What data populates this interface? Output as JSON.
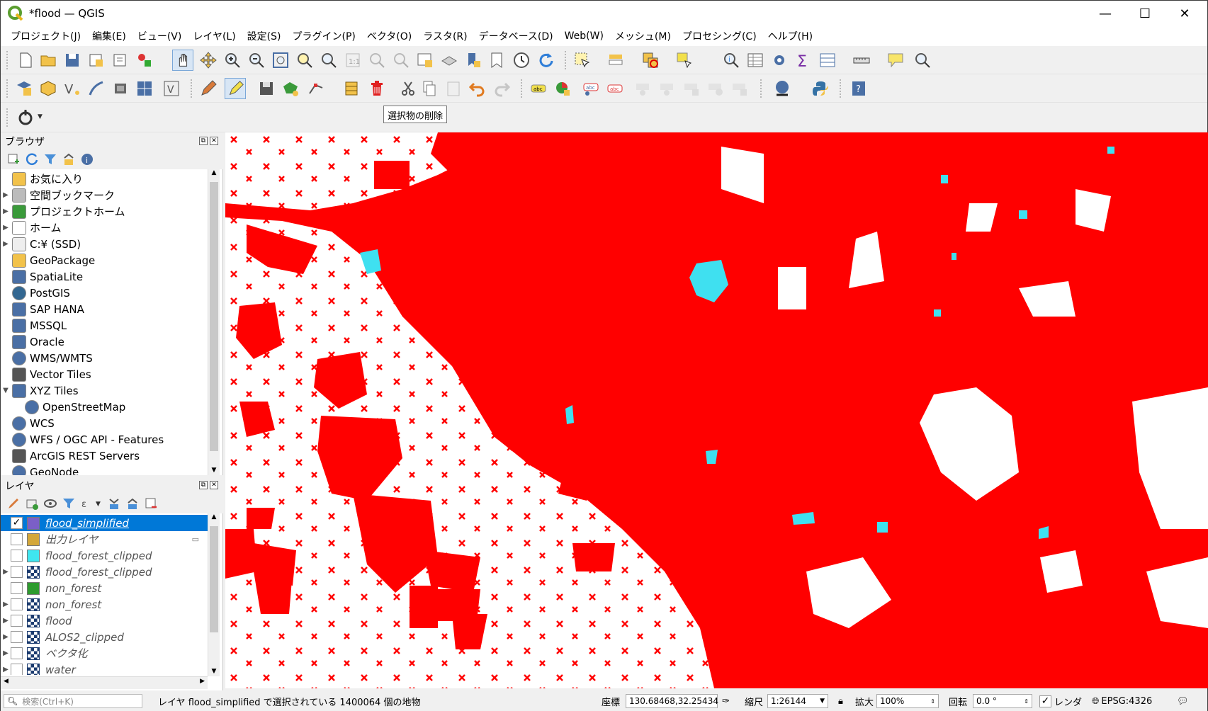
{
  "window": {
    "title": "*flood — QGIS"
  },
  "menu": [
    "プロジェクト(J)",
    "編集(E)",
    "ビュー(V)",
    "レイヤ(L)",
    "設定(S)",
    "プラグイン(P)",
    "ベクタ(O)",
    "ラスタ(R)",
    "データベース(D)",
    "Web(W)",
    "メッシュ(M)",
    "プロセシング(C)",
    "ヘルプ(H)"
  ],
  "tooltip": {
    "text": "選択物の削除"
  },
  "browser": {
    "title": "ブラウザ",
    "items": [
      {
        "label": "お気に入り",
        "arrow": "",
        "icon": "star-icon"
      },
      {
        "label": "空間ブックマーク",
        "arrow": "▶",
        "icon": "bookmark-icon"
      },
      {
        "label": "プロジェクトホーム",
        "arrow": "▶",
        "icon": "project-home-icon"
      },
      {
        "label": "ホーム",
        "arrow": "▶",
        "icon": "home-icon"
      },
      {
        "label": "C:¥ (SSD)",
        "arrow": "▶",
        "icon": "drive-icon"
      },
      {
        "label": "GeoPackage",
        "arrow": "",
        "icon": "geopackage-icon"
      },
      {
        "label": "SpatiaLite",
        "arrow": "",
        "icon": "spatialite-icon"
      },
      {
        "label": "PostGIS",
        "arrow": "",
        "icon": "postgis-icon"
      },
      {
        "label": "SAP HANA",
        "arrow": "",
        "icon": "hana-icon"
      },
      {
        "label": "MSSQL",
        "arrow": "",
        "icon": "mssql-icon"
      },
      {
        "label": "Oracle",
        "arrow": "",
        "icon": "oracle-icon"
      },
      {
        "label": "WMS/WMTS",
        "arrow": "",
        "icon": "wms-icon"
      },
      {
        "label": "Vector Tiles",
        "arrow": "",
        "icon": "vector-tiles-icon"
      },
      {
        "label": "XYZ Tiles",
        "arrow": "▼",
        "icon": "xyz-icon"
      },
      {
        "label": "OpenStreetMap",
        "arrow": "",
        "icon": "osm-icon",
        "indent": true
      },
      {
        "label": "WCS",
        "arrow": "",
        "icon": "wcs-icon"
      },
      {
        "label": "WFS / OGC API - Features",
        "arrow": "",
        "icon": "wfs-icon"
      },
      {
        "label": "ArcGIS REST Servers",
        "arrow": "",
        "icon": "arcgis-icon"
      },
      {
        "label": "GeoNode",
        "arrow": "",
        "icon": "geonode-icon"
      }
    ]
  },
  "layers": {
    "title": "レイヤ",
    "items": [
      {
        "label": "flood_simplified",
        "checked": true,
        "arrow": "",
        "swatch": "#7b5fc7",
        "selected": true
      },
      {
        "label": "出力レイヤ",
        "checked": false,
        "arrow": "",
        "swatch": "#d4a73a"
      },
      {
        "label": "flood_forest_clipped",
        "checked": false,
        "arrow": "",
        "swatch": "#3fe6f0"
      },
      {
        "label": "flood_forest_clipped",
        "checked": false,
        "arrow": "▶",
        "swatch": "raster"
      },
      {
        "label": "non_forest",
        "checked": false,
        "arrow": "",
        "swatch": "#2e9b2e"
      },
      {
        "label": "non_forest",
        "checked": false,
        "arrow": "▶",
        "swatch": "raster"
      },
      {
        "label": "flood",
        "checked": false,
        "arrow": "▶",
        "swatch": "raster"
      },
      {
        "label": "ALOS2_clipped",
        "checked": false,
        "arrow": "▶",
        "swatch": "raster"
      },
      {
        "label": "ベクタ化",
        "checked": false,
        "arrow": "▶",
        "swatch": "raster"
      },
      {
        "label": "water",
        "checked": false,
        "arrow": "▶",
        "swatch": "raster"
      }
    ]
  },
  "status": {
    "search_placeholder": "検索(Ctrl+K)",
    "message": "レイヤ flood_simplified で選択されている 1400064 個の地物",
    "coord_label": "座標",
    "coord_value": "130.68468,32.25434",
    "scale_label": "縮尺",
    "scale_value": "1:26144",
    "magnifier_label": "拡大",
    "magnifier_value": "100%",
    "rotation_label": "回転",
    "rotation_value": "0.0 °",
    "render_label": "レンダ",
    "crs": "EPSG:4326"
  },
  "colors": {
    "flood": "#ff0000",
    "water": "#3fe0f0",
    "highlight": "#e60000",
    "selected": "#0078d7"
  }
}
